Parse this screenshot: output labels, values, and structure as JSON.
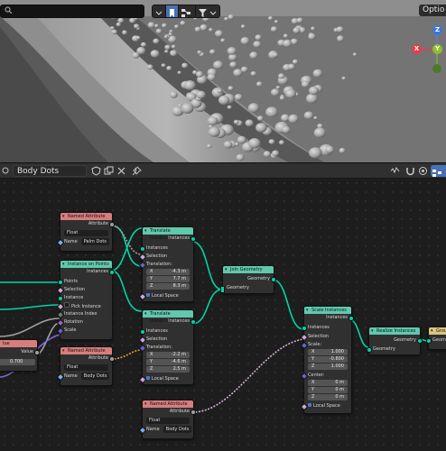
{
  "viewport": {
    "options_label": "Optio",
    "gizmo": {
      "z": "Z",
      "y": "Y",
      "x": "X"
    }
  },
  "node_editor_header": {
    "tree_name": "Body Dots"
  },
  "nodes": {
    "named_attr_1": {
      "title": "Named Attribute",
      "out": "Attribute",
      "type": "Float",
      "name_label": "Name",
      "name_value": "Palm Dots"
    },
    "instance_on_points": {
      "title": "Instance on Points",
      "out": "Instances",
      "inputs": [
        "Points",
        "Selection",
        "Instance",
        "Pick Instance",
        "Instance Index",
        "Rotation",
        "Scale"
      ]
    },
    "translate_1": {
      "title": "Translate Instances",
      "out": "Instances",
      "inputs": [
        "Instances",
        "Selection",
        "Translation:"
      ],
      "x": "-4.3 m",
      "y": "7.7 m",
      "z": "8.3 m",
      "local": "Local Space"
    },
    "join_geometry": {
      "title": "Join Geometry",
      "out": "Geometry",
      "in": "Geometry"
    },
    "translate_2": {
      "title": "Translate Instances",
      "out": "Instances",
      "inputs": [
        "Instances",
        "Selection",
        "Translation:"
      ],
      "x": "-2.2 m",
      "y": "-4.6 m",
      "z": "2.5 m",
      "local": "Local Space"
    },
    "named_attr_2": {
      "title": "Named Attribute",
      "out": "Attribute",
      "type": "Float",
      "name_label": "Name",
      "name_value": "Body Dots"
    },
    "named_attr_3": {
      "title": "Named Attribute",
      "out": "Attribute",
      "type": "Float",
      "name_label": "Name",
      "name_value": "Body Dots"
    },
    "value_node": {
      "title": "lue",
      "out": "Value",
      "value": "0.700"
    },
    "scale_instances": {
      "title": "Scale Instances",
      "out": "Instances",
      "inputs": [
        "Instances",
        "Selection",
        "Scale:"
      ],
      "x": "1.000",
      "y": "-0.800",
      "z": "1.000",
      "center_label": "Center:",
      "cx": "0 m",
      "cy": "0 m",
      "cz": "0 m",
      "local": "Local Space"
    },
    "realize_instances": {
      "title": "Realize Instances",
      "out": "Geometry",
      "in": "Geometry"
    },
    "group_output": {
      "title": "Grou",
      "in": "Geom"
    }
  },
  "labels": {
    "x": "X",
    "y": "Y",
    "z": "Z"
  },
  "colors": {
    "header_attribute": "#d77d7d",
    "header_geometry": "#5fc9ad",
    "header_output": "#d9c77a",
    "socket_geometry": "#00d6a3",
    "socket_float": "#a1a1a1",
    "socket_vector": "#6363c7",
    "socket_boolean": "#cca6d6"
  }
}
